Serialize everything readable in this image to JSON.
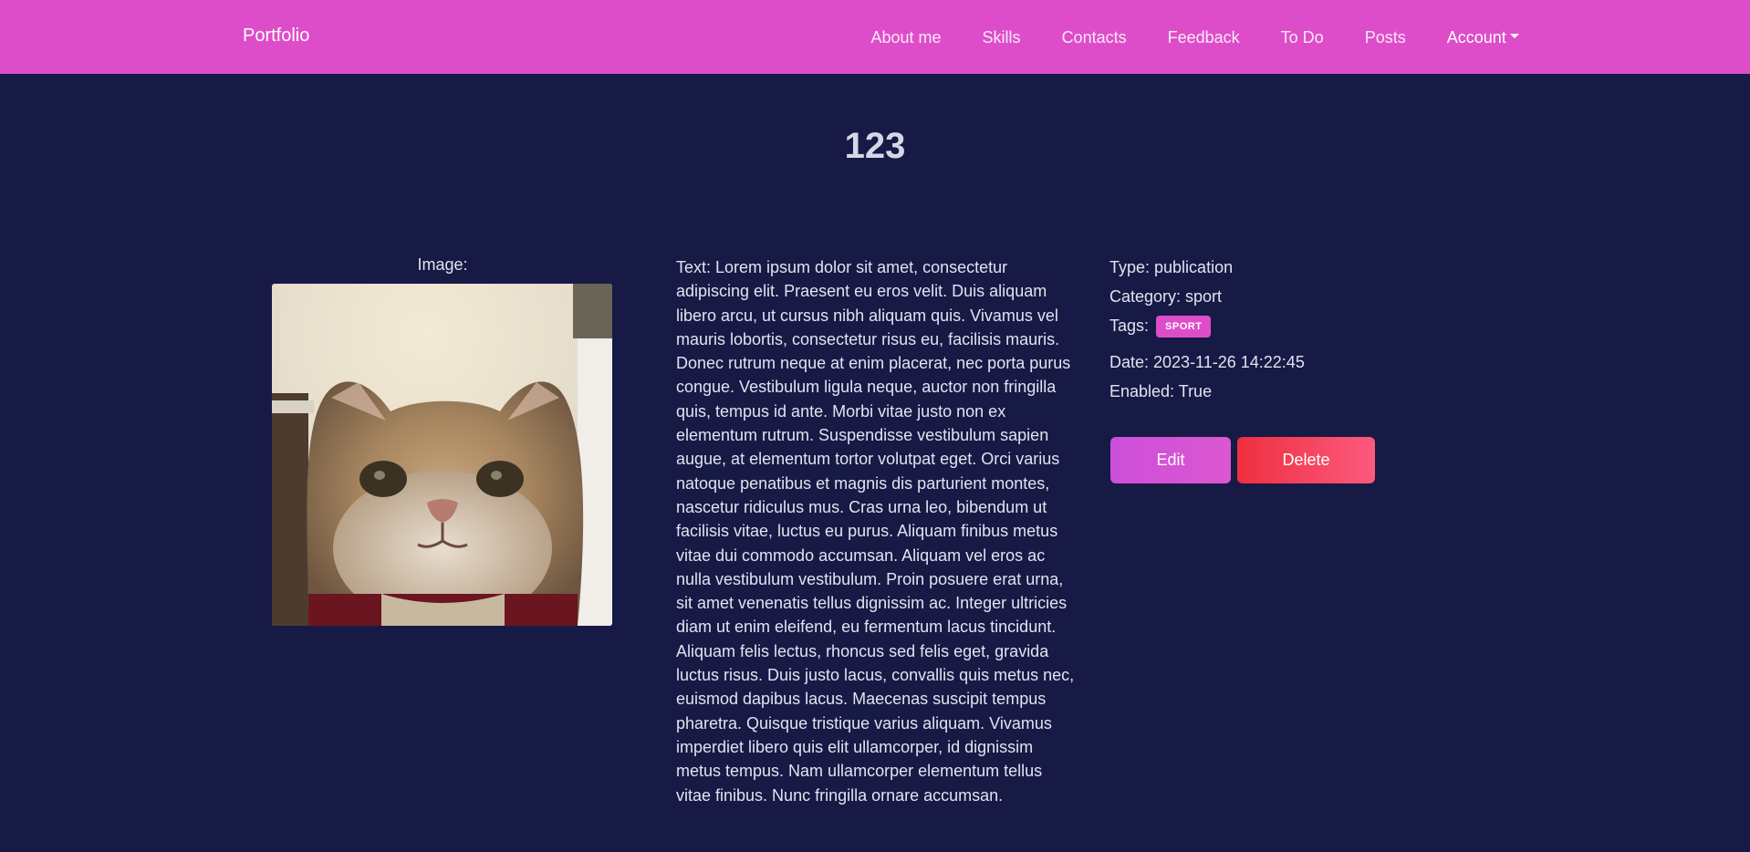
{
  "navbar": {
    "brand": "Portfolio",
    "items": [
      {
        "label": "About me"
      },
      {
        "label": "Skills"
      },
      {
        "label": "Contacts"
      },
      {
        "label": "Feedback"
      },
      {
        "label": "To Do"
      },
      {
        "label": "Posts"
      },
      {
        "label": "Account"
      }
    ],
    "bg_color": "#de4dc9"
  },
  "post": {
    "title": "123",
    "image_label": "Image:",
    "text": "Text: Lorem ipsum dolor sit amet, consectetur adipiscing elit. Praesent eu eros velit. Duis aliquam libero arcu, ut cursus nibh aliquam quis. Vivamus vel mauris lobortis, consectetur risus eu, facilisis mauris. Donec rutrum neque at enim placerat, nec porta purus congue. Vestibulum ligula neque, auctor non fringilla quis, tempus id ante. Morbi vitae justo non ex elementum rutrum. Suspendisse vestibulum sapien augue, at elementum tortor volutpat eget. Orci varius natoque penatibus et magnis dis parturient montes, nascetur ridiculus mus. Cras urna leo, bibendum ut facilisis vitae, luctus eu purus. Aliquam finibus metus vitae dui commodo accumsan. Aliquam vel eros ac nulla vestibulum vestibulum. Proin posuere erat urna, sit amet venenatis tellus dignissim ac. Integer ultricies diam ut enim eleifend, eu fermentum lacus tincidunt. Aliquam felis lectus, rhoncus sed felis eget, gravida luctus risus. Duis justo lacus, convallis quis metus nec, euismod dapibus lacus. Maecenas suscipit tempus pharetra. Quisque tristique varius aliquam. Vivamus imperdiet libero quis elit ullamcorper, id dignissim metus tempus. Nam ullamcorper elementum tellus vitae finibus. Nunc fringilla ornare accumsan.",
    "type": "Type: publication",
    "category": "Category: sport",
    "tags_label": "Tags:",
    "tags": [
      "SPORT"
    ],
    "date": "Date: 2023-11-26 14:22:45",
    "enabled": "Enabled: True"
  },
  "actions": {
    "edit_label": "Edit",
    "delete_label": "Delete"
  },
  "colors": {
    "background": "#171a45",
    "accent": "#de4dc9",
    "danger": "#ef2f3e"
  }
}
